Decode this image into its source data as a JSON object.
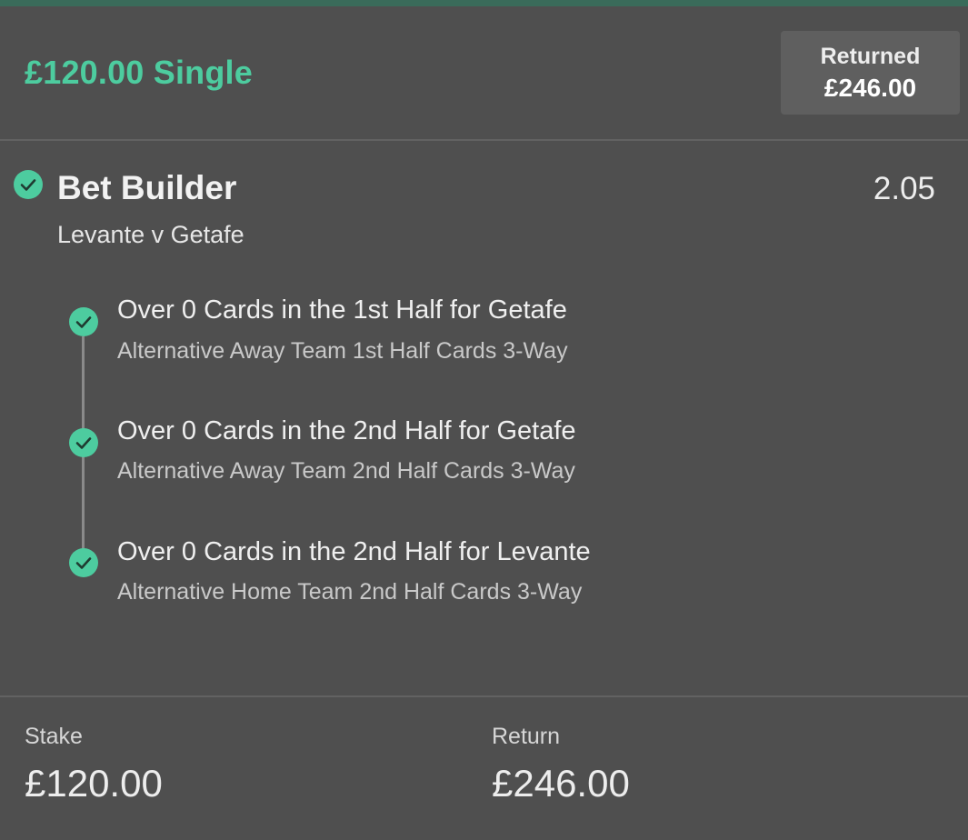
{
  "header": {
    "title": "£120.00 Single",
    "returned_label": "Returned",
    "returned_value": "£246.00"
  },
  "bet_builder": {
    "title": "Bet Builder",
    "odds": "2.05",
    "match": "Levante v Getafe",
    "selections": [
      {
        "title": "Over 0 Cards in the 1st Half for Getafe",
        "market": "Alternative Away Team 1st Half Cards 3-Way",
        "status_icon": "check-circle-icon"
      },
      {
        "title": "Over 0 Cards in the 2nd Half for Getafe",
        "market": "Alternative Away Team 2nd Half Cards 3-Way",
        "status_icon": "check-circle-icon"
      },
      {
        "title": "Over 0 Cards in the 2nd Half for Levante",
        "market": "Alternative Home Team 2nd Half Cards 3-Way",
        "status_icon": "check-circle-icon"
      }
    ]
  },
  "footer": {
    "stake_label": "Stake",
    "stake_value": "£120.00",
    "return_label": "Return",
    "return_value": "£246.00"
  },
  "colors": {
    "background": "#4f4f4f",
    "accent_green": "#4dcc9f",
    "top_bar": "#3a6b5a",
    "badge_background": "#5f5f5f"
  }
}
